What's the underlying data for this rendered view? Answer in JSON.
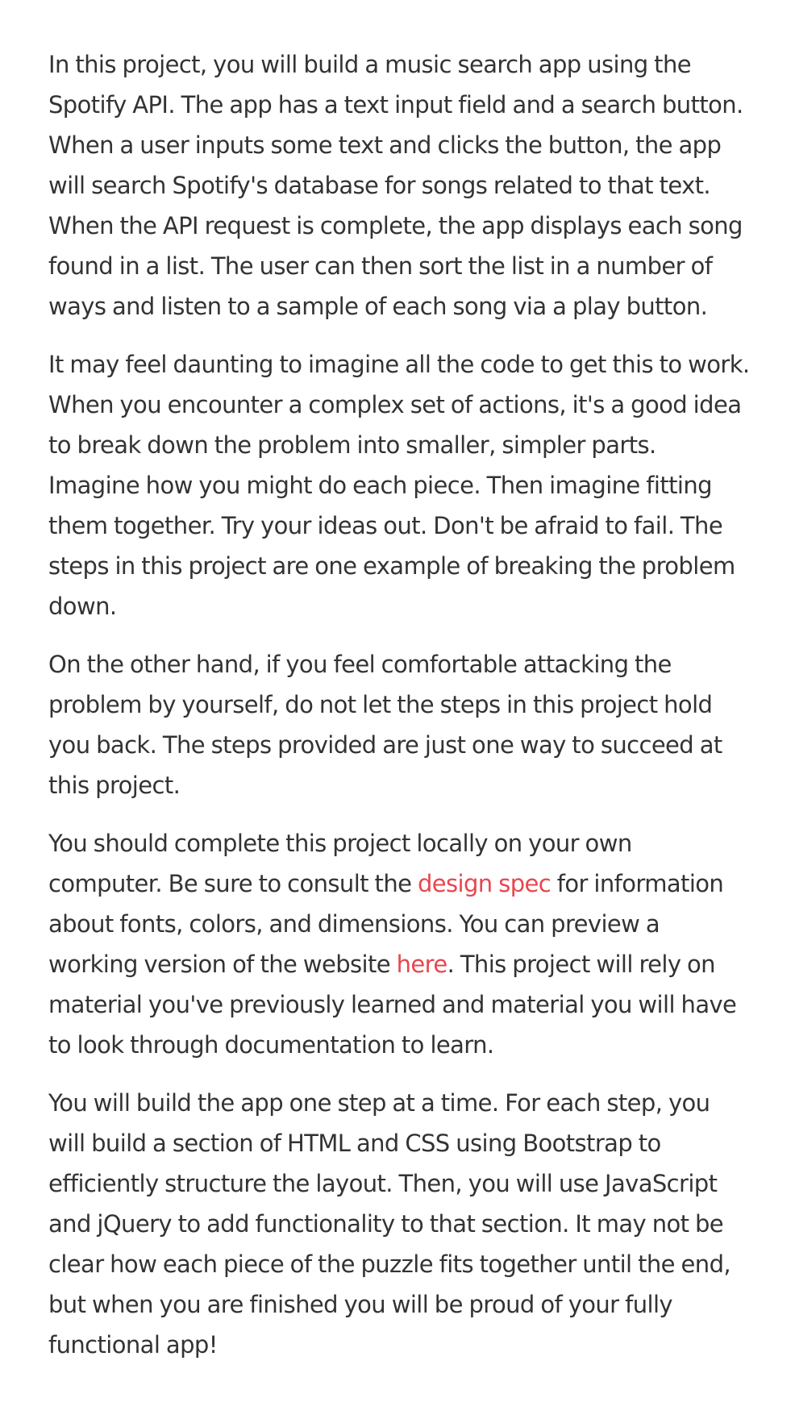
{
  "paragraphs": [
    {
      "lines": [
        "In this project, you will build a music search app using the",
        "Spotify API. The app has a text input field and a search button.",
        "When a user inputs some text and clicks the button, the app",
        "will search Spotify's database for songs related to that text.",
        "When the API request is complete, the app displays each song",
        "found in a list. The user can then sort the list in a number of",
        "ways and listen to a sample of each song via a play button."
      ]
    },
    {
      "lines": [
        "It may feel daunting to imagine all the code to get this to work.",
        "When you encounter a complex set of actions, it's a good idea",
        "to break down the problem into smaller, simpler parts.",
        "Imagine how you might do each piece. Then imagine fitting",
        "them together. Try your ideas out. Don't be afraid to fail. The",
        "steps in this project are one example of breaking the problem",
        "down."
      ]
    },
    {
      "lines": [
        "On the other hand, if you feel comfortable attacking the",
        "problem by yourself, do not let the steps in this project hold",
        "you back. The steps provided are just one way to succeed at",
        "this project."
      ]
    },
    {
      "line1": "You should complete this project locally on your own",
      "line2_before": "computer. Be sure to consult the ",
      "link_design_spec": "design spec",
      "line2_after": " for information",
      "line3": "about fonts, colors, and dimensions. You can preview a",
      "line4_before": "working version of the website ",
      "link_here": "here",
      "line4_after": ". This project will rely on",
      "line5": "material you've previously learned and material you will have",
      "line6": "to look through documentation to learn."
    },
    {
      "lines": [
        "You will build the app one step at a time. For each step, you",
        "will build a section of HTML and CSS using Bootstrap to",
        "efficiently structure the layout. Then, you will use JavaScript",
        "and jQuery to add functionality to that section. It may not be",
        "clear how each piece of the puzzle fits together until the end,",
        "but when you are finished you will be proud of your fully",
        "functional app!"
      ]
    }
  ],
  "colors": {
    "text": "#333333",
    "link": "#e8464e",
    "background": "#ffffff"
  }
}
